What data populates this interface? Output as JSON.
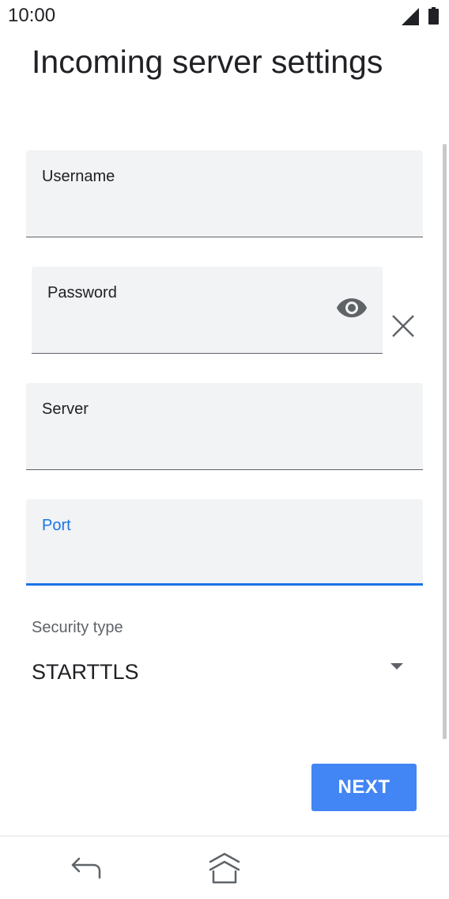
{
  "status_bar": {
    "time": "10:00",
    "icons": [
      "signal-icon",
      "battery-icon"
    ]
  },
  "page": {
    "title": "Incoming server settings"
  },
  "fields": {
    "username": {
      "label": "Username",
      "value": ""
    },
    "password": {
      "label": "Password",
      "value": "",
      "icons": [
        "eye-icon",
        "clear-icon"
      ]
    },
    "server": {
      "label": "Server",
      "value": ""
    },
    "port": {
      "label": "Port",
      "value": "",
      "focused": true
    }
  },
  "security": {
    "label": "Security type",
    "selected": "STARTTLS"
  },
  "actions": {
    "next_label": "NEXT"
  },
  "nav_bar": {
    "icons": [
      "back-icon",
      "home-icon"
    ]
  },
  "colors": {
    "accent": "#1a73e8",
    "button": "#4285f4",
    "field_bg": "#f1f3f4",
    "text": "#202124",
    "secondary_text": "#5f6368"
  }
}
